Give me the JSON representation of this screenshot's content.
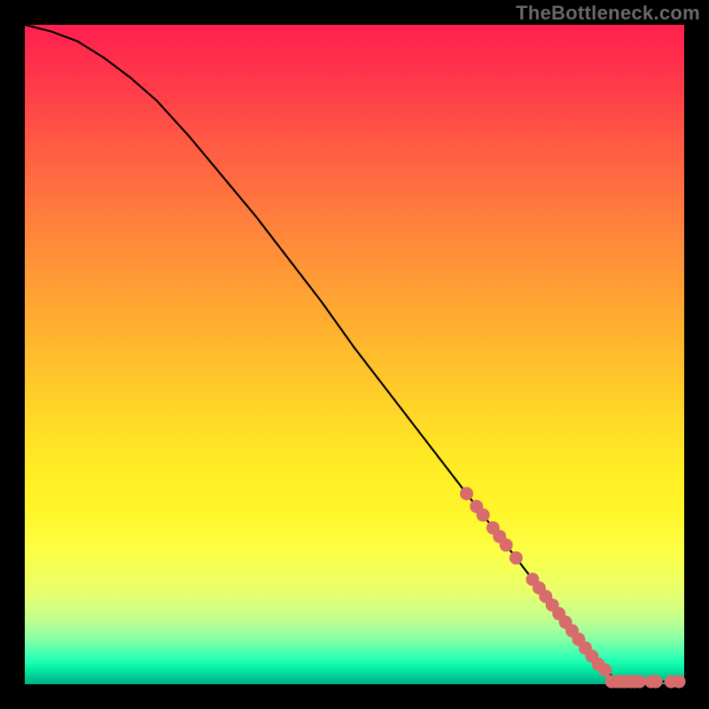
{
  "watermark": "TheBottleneck.com",
  "chart_data": {
    "type": "line",
    "title": "",
    "xlabel": "",
    "ylabel": "",
    "xlim": [
      0,
      100
    ],
    "ylim": [
      0,
      100
    ],
    "curve": {
      "x": [
        0,
        4,
        8,
        12,
        16,
        20,
        25,
        30,
        35,
        40,
        45,
        50,
        55,
        60,
        65,
        70,
        75,
        80,
        85,
        87,
        89,
        91,
        100
      ],
      "y": [
        100,
        99,
        97.5,
        95,
        92,
        88.5,
        83,
        77,
        71,
        64.5,
        58,
        51,
        44.5,
        38,
        31.5,
        25,
        18.5,
        12,
        5.5,
        3,
        1.3,
        0.4,
        0.4
      ]
    },
    "points_on_curve_x": [
      67,
      68.5,
      69.5,
      71,
      72,
      73,
      74.5,
      77,
      78,
      79,
      80,
      81,
      82,
      83,
      84,
      85,
      86,
      87,
      88
    ],
    "points_flat_x": [
      89,
      89.7,
      90.3,
      91,
      91.8,
      92.5,
      93.2,
      95,
      95.7,
      98,
      99.2
    ],
    "flat_y": 0.4,
    "note": "Axes are unlabeled; values are read off the plot area on a 0–100 normalized scale for both axes. Curve starts at top-left (0,100), descends roughly linearly after an initial shoulder, and flattens near the bottom-right around x≈89. Pink dots cluster along the curve's lower segment (x≈67–88) and along the flat tail (x≈89–99)."
  }
}
